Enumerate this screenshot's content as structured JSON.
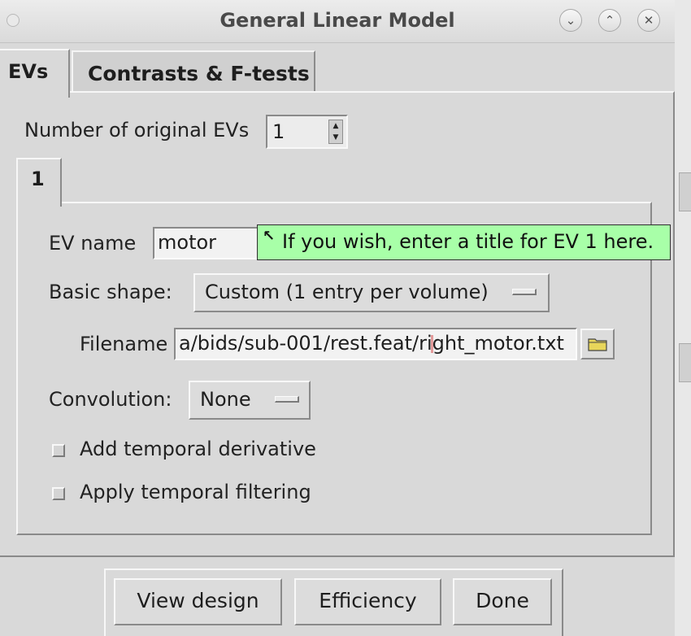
{
  "window": {
    "title": "General Linear Model",
    "controls": {
      "minimize_glyph": "⌄",
      "maximize_glyph": "⌃",
      "close_glyph": "✕"
    }
  },
  "tabs": [
    {
      "label": "EVs",
      "active": true
    },
    {
      "label": "Contrasts & F-tests",
      "active": false
    }
  ],
  "evs": {
    "num_label": "Number of original EVs",
    "num_value": "1",
    "ev_tabs": [
      {
        "label": "1",
        "active": true
      }
    ],
    "ev1": {
      "name_label": "EV name",
      "name_value": "motor",
      "tooltip": "If you wish, enter a title for EV 1 here.",
      "shape_label": "Basic shape:",
      "shape_value": "Custom (1 entry per volume)",
      "filename_label": "Filename",
      "filename_value": "a/bids/sub-001/rest.feat/right_motor.txt",
      "convolution_label": "Convolution:",
      "convolution_value": "None",
      "options": [
        {
          "label": "Add temporal derivative",
          "checked": false
        },
        {
          "label": "Apply temporal filtering",
          "checked": false
        }
      ]
    }
  },
  "buttons": {
    "view_design": "View design",
    "efficiency": "Efficiency",
    "done": "Done"
  },
  "icons": {
    "folder": "folder-icon",
    "spin_up": "▲",
    "spin_down": "▼",
    "tooltip_arrow": "↖"
  },
  "colors": {
    "tooltip_bg": "#a8ffa8",
    "window_bg": "#d9d9d9"
  }
}
